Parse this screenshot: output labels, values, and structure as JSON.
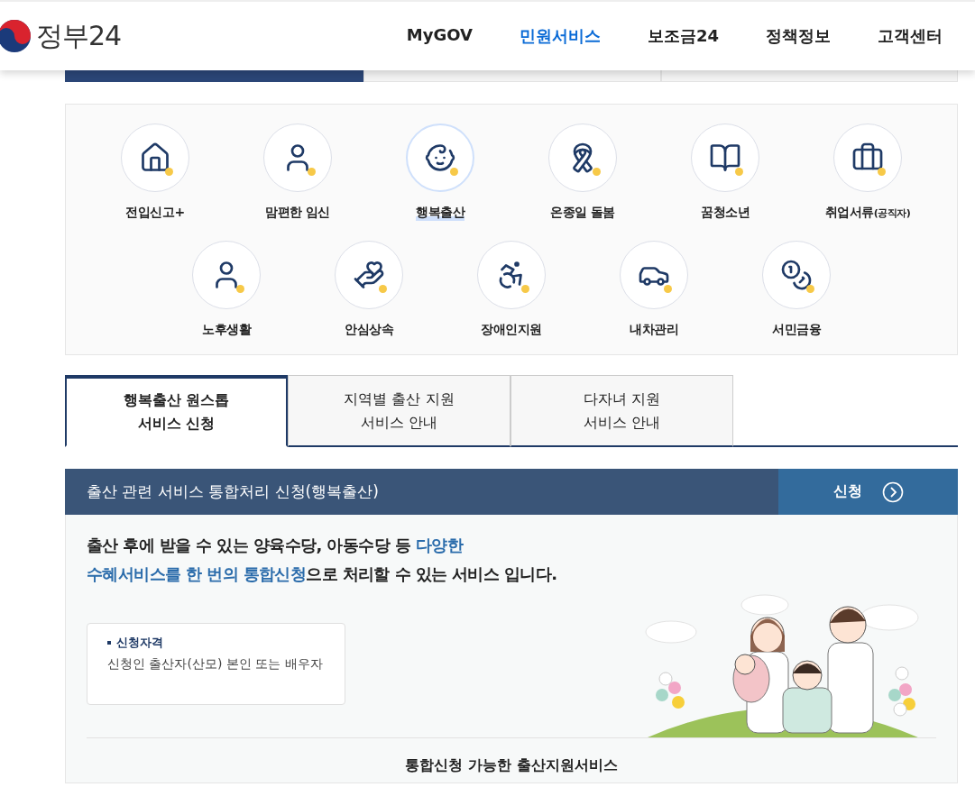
{
  "header": {
    "logo_text": "정부24",
    "nav": [
      {
        "label": "MyGOV",
        "selected": false
      },
      {
        "label": "민원서비스",
        "selected": true
      },
      {
        "label": "보조금24",
        "selected": false
      },
      {
        "label": "정책정보",
        "selected": false
      },
      {
        "label": "고객센터",
        "selected": false
      }
    ]
  },
  "top_tabs": [
    {
      "selected": true
    },
    {
      "selected": false
    },
    {
      "selected": false
    }
  ],
  "services": [
    {
      "label": "전입신고+",
      "selected": false
    },
    {
      "label": "맘편한 임신",
      "selected": false
    },
    {
      "label": "행복출산",
      "selected": true
    },
    {
      "label": "온종일 돌봄",
      "selected": false
    },
    {
      "label": "꿈청소년",
      "selected": false
    },
    {
      "label": "취업서류",
      "note": "(공직자)",
      "selected": false
    },
    {
      "label": "노후생활",
      "selected": false
    },
    {
      "label": "안심상속",
      "selected": false
    },
    {
      "label": "장애인지원",
      "selected": false
    },
    {
      "label": "내차관리",
      "selected": false
    },
    {
      "label": "서민금융",
      "selected": false
    }
  ],
  "sub_tabs": [
    {
      "lines": [
        "행복출산 원스톱",
        "서비스 신청"
      ],
      "selected": true
    },
    {
      "lines": [
        "지역별 출산 지원",
        "서비스 안내"
      ],
      "selected": false
    },
    {
      "lines": [
        "다자녀 지원",
        "서비스 안내"
      ],
      "selected": false
    }
  ],
  "apply_bar": {
    "title": "출산 관련 서비스 통합처리 신청(행복출산)",
    "button": "신청"
  },
  "intro": [
    [
      {
        "text": "출산 후에 받을 수 있는 양육수당, 아동수당 등 ",
        "highlight": false
      },
      {
        "text": "다양한",
        "highlight": true
      }
    ],
    [
      {
        "text": "수혜서비스를 한 번의 통합신청",
        "highlight": true
      },
      {
        "text": "으로 처리할 수 있는 서비스 입니다.",
        "highlight": false
      }
    ]
  ],
  "eligibility": {
    "title": "신청자격",
    "text": "신청인 출산자(산모) 본인 또는 배우자"
  },
  "section_title": "통합신청 가능한 출산지원서비스"
}
